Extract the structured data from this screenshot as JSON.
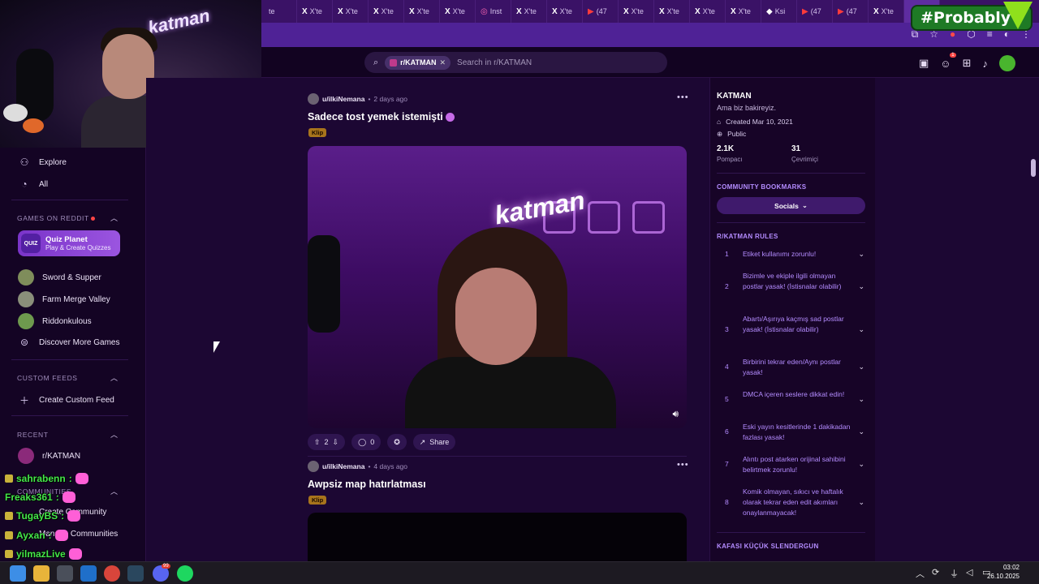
{
  "browser": {
    "tabs": [
      {
        "icon": "",
        "label": "te"
      },
      {
        "icon": "X",
        "label": "X'te"
      },
      {
        "icon": "X",
        "label": "X'te"
      },
      {
        "icon": "X",
        "label": "X'te"
      },
      {
        "icon": "X",
        "label": "X'te"
      },
      {
        "icon": "X",
        "label": "X'te"
      },
      {
        "icon": "◎",
        "label": "Inst"
      },
      {
        "icon": "X",
        "label": "X'te"
      },
      {
        "icon": "X",
        "label": "X'te"
      },
      {
        "icon": "▶",
        "label": "(47"
      },
      {
        "icon": "X",
        "label": "X'te"
      },
      {
        "icon": "X",
        "label": "X'te"
      },
      {
        "icon": "X",
        "label": "X'te"
      },
      {
        "icon": "X",
        "label": "X'te"
      },
      {
        "icon": "◆",
        "label": "Ksi"
      },
      {
        "icon": "▶",
        "label": "(47"
      },
      {
        "icon": "▶",
        "label": "(47"
      },
      {
        "icon": "X",
        "label": "X'te"
      },
      {
        "icon": "",
        "label": "◀) ×"
      }
    ],
    "overlay_badge": "#Probably"
  },
  "header": {
    "search_chip": "r/KATMAN",
    "search_placeholder": "Search in r/KATMAN",
    "notification_count": "1"
  },
  "sidebar": {
    "explore": "Explore",
    "all": "All",
    "games_section": "GAMES ON REDDIT",
    "quiz_title": "Quiz Planet",
    "quiz_sub": "Play & Create Quizzes",
    "quiz_icon_text": "QUIZ",
    "games": [
      "Sword & Supper",
      "Farm Merge Valley",
      "Riddonkulous"
    ],
    "discover": "Discover More Games",
    "custom_feeds_section": "CUSTOM FEEDS",
    "create_custom_feed": "Create Custom Feed",
    "recent_section": "RECENT",
    "recent_item": "r/KATMAN",
    "communities_section": "COMMUNITIES",
    "create_community": "Create Community",
    "manage_communities": "Manage Communities"
  },
  "chat": [
    {
      "user": "sahrabenn",
      "sep": ":"
    },
    {
      "user": "Freaks361",
      "sep": ":"
    },
    {
      "user": "TugayBS",
      "sep": ":"
    },
    {
      "user": "Ayxan",
      "sep": ":"
    },
    {
      "user": "yilmazLive",
      "sep": ":"
    }
  ],
  "posts": [
    {
      "user": "u/ilkiNemana",
      "time": "2 days ago",
      "title": "Sadece tost yemek istemişti",
      "flair": "Klip",
      "score": "2",
      "comments": "0",
      "share": "Share"
    },
    {
      "user": "u/ilkiNemana",
      "time": "4 days ago",
      "title": "Awpsiz map hatırlatması",
      "flair": "Klip"
    }
  ],
  "community": {
    "name": "KATMAN",
    "description": "Ama biz bakireyiz.",
    "created": "Created Mar 10, 2021",
    "visibility": "Public",
    "members_value": "2.1K",
    "members_label": "Pompacı",
    "online_value": "31",
    "online_label": "Çevrimiçi",
    "bookmarks_section": "COMMUNITY BOOKMARKS",
    "socials_button": "Socials",
    "rules_section": "R/KATMAN RULES",
    "rules": [
      {
        "n": "1",
        "text": "Etiket kullanımı zorunlu!"
      },
      {
        "n": "2",
        "text": "Bizimle ve ekiple ilgili olmayan postlar yasak! (İstisnalar olabilir)"
      },
      {
        "n": "3",
        "text": "Abartı/Aşırıya kaçmış sad postlar yasak! (İstisnalar olabilir)"
      },
      {
        "n": "4",
        "text": "Birbirini tekrar eden/Aynı postlar yasak!"
      },
      {
        "n": "5",
        "text": "DMCA içeren seslere dikkat edin!"
      },
      {
        "n": "6",
        "text": "Eski yayın kesitlerinde 1 dakikadan fazlası yasak!"
      },
      {
        "n": "7",
        "text": "Alıntı post atarken orijinal sahibini belirtmek zorunlu!"
      },
      {
        "n": "8",
        "text": "Komik olmayan, sıkıcı ve haftalık olarak tekrar eden edit akımları onaylanmayacak!"
      }
    ],
    "next_section": "KAFASI KÜÇÜK SLENDERGUN"
  },
  "taskbar": {
    "time": "03:02",
    "date": "26.10.2025",
    "badge": "99"
  }
}
